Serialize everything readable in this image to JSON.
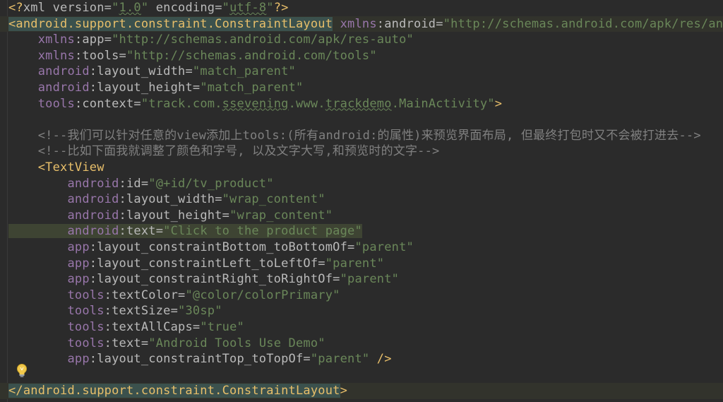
{
  "colors": {
    "background": "#2b2b2b",
    "tag": "#e8bf6a",
    "attribute": "#bababa",
    "namespace": "#9876aa",
    "string": "#6a8759",
    "comment": "#808080"
  },
  "lines": [
    [
      "<?xml version=\"1.0\" encoding=\"utf-8\"?>"
    ],
    [
      "<android.support.constraint.ConstraintLayout xmlns:android=\"http://schemas.android.com/apk/res/an"
    ],
    [
      "    xmlns:app=\"http://schemas.android.com/apk/res-auto\""
    ],
    [
      "    xmlns:tools=\"http://schemas.android.com/tools\""
    ],
    [
      "    android:layout_width=\"match_parent\""
    ],
    [
      "    android:layout_height=\"match_parent\""
    ],
    [
      "    tools:context=\"track.com.ssevening.www.trackdemo.MainActivity\">"
    ],
    [
      ""
    ],
    [
      "    <!--我们可以针对任意的view添加上tools:(所有android:的属性)来预览界面布局, 但最终打包时又不会被打进去-->"
    ],
    [
      "    <!--比如下面我就调整了颜色和字号, 以及文字大写,和预览时的文字-->"
    ],
    [
      "    <TextView"
    ],
    [
      "        android:id=\"@+id/tv_product\""
    ],
    [
      "        android:layout_width=\"wrap_content\""
    ],
    [
      "        android:layout_height=\"wrap_content\""
    ],
    [
      "        android:text=\"Click to the product page\""
    ],
    [
      "        app:layout_constraintBottom_toBottomOf=\"parent\""
    ],
    [
      "        app:layout_constraintLeft_toLeftOf=\"parent\""
    ],
    [
      "        app:layout_constraintRight_toRightOf=\"parent\""
    ],
    [
      "        tools:textColor=\"@color/colorPrimary\""
    ],
    [
      "        tools:textSize=\"30sp\""
    ],
    [
      "        tools:textAllCaps=\"true\""
    ],
    [
      "        tools:text=\"Android Tools Use Demo\""
    ],
    [
      "        app:layout_constraintTop_toTopOf=\"parent\" />"
    ],
    [
      ""
    ],
    [
      "</android.support.constraint.ConstraintLayout>"
    ]
  ],
  "icons": {
    "intention_bulb": "lightbulb-icon"
  }
}
